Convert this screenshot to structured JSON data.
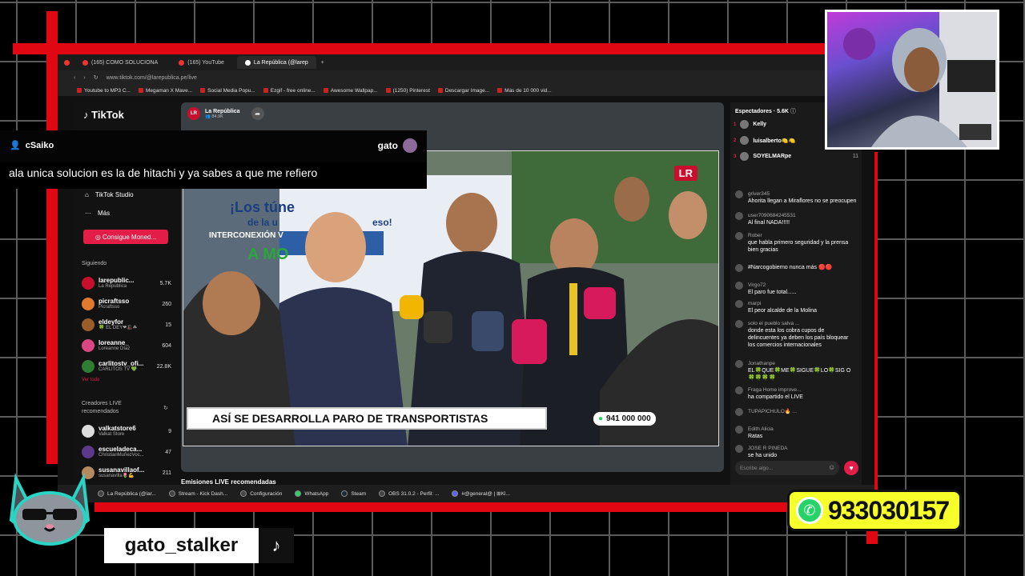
{
  "browser": {
    "tabs": [
      "(165) COMO SOLUCIONA",
      "(165) YouTube",
      "La República (@larep"
    ],
    "address": "www.tiktok.com/@larepublica.pe/live",
    "bookmarks": [
      "Youtube to MP3 C...",
      "Megaman X Mave...",
      "Social Media Popu...",
      "Ezgif - free online...",
      "Awesome Wallpap...",
      "(1250) Pinterest",
      "Descargar Image...",
      "Más de 10 000 vid..."
    ]
  },
  "tiktok": {
    "logo": "TikTok",
    "nav": {
      "studio": "TikTok Studio",
      "more": "Más",
      "coins": "Consigue Moned..."
    },
    "following_header": "Siguiendo",
    "following": [
      {
        "name": "larepublic...",
        "sub": "La República",
        "count": "5.7K",
        "color": "#c8102e"
      },
      {
        "name": "picraftsso",
        "sub": "Picraftsso",
        "count": "260",
        "color": "#e07a2f"
      },
      {
        "name": "eldeyfor",
        "sub": "🍀 EL DEY❤🎩☘",
        "count": "15",
        "color": "#9b5d2a"
      },
      {
        "name": "loreanne_",
        "sub": "Loreanne Díaz",
        "count": "604",
        "color": "#d94680"
      },
      {
        "name": "carlitostv_ofi...",
        "sub": "CARLITOS TV 💚",
        "count": "22.8K",
        "color": "#2e7d32"
      }
    ],
    "see_all": "Ver todo",
    "recommended_header": "Creadores LIVE recomendados",
    "recommended": [
      {
        "name": "valkatstore6",
        "sub": "Valkat Store",
        "count": "9",
        "color": "#ddd"
      },
      {
        "name": "escueladeca...",
        "sub": "ChristianMuñezVoc...",
        "count": "47",
        "color": "#5b3a8a"
      },
      {
        "name": "susanavillaof...",
        "sub": "susanavilla🌷💪",
        "count": "211",
        "color": "#b58a60"
      }
    ],
    "channel_name": "La República",
    "channel_viewers": "84.9K",
    "recommended_live": "Emisiones LIVE recomendadas"
  },
  "video": {
    "banner": "ASÍ SE DESARROLLA PARO DE TRANSPORTISTAS",
    "whatsapp": "941 000 000",
    "logo": "LR",
    "poster_line1": "¡Los túne",
    "poster_line2": "de la u",
    "poster_line3": "eso!",
    "poster_line4": "INTERCONEXIÓN V",
    "poster_line5": "A MO"
  },
  "viewers_panel": {
    "title": "Espectadores · 5.6K",
    "top": [
      {
        "rank": "1",
        "name": "Kelly"
      },
      {
        "rank": "2",
        "name": "luisalberto🍋🍋"
      },
      {
        "rank": "3",
        "name": "SOYELMARpe",
        "count": "11"
      }
    ]
  },
  "chat": [
    {
      "user": "griver345",
      "text": "Ahorita llegan a Miraflores no se preocupen"
    },
    {
      "user": "user7090684245531",
      "text": "Al final NADA!!!!!"
    },
    {
      "user": "Rober",
      "text": "que habla primero seguridad y la prensa bien gracias"
    },
    {
      "user": "",
      "text": "#Narcogobierno nunca más 🔴🔴"
    },
    {
      "user": "Virgo72",
      "text": "El paro fue total......"
    },
    {
      "user": "marpi",
      "text": "El peor alcalde de la Molina"
    },
    {
      "user": "solo el pueblo salva ...",
      "text": "donde esta los cobra cupos de delincuentes ya deben los país bloquear los comercios internacionales"
    },
    {
      "user": "Jonathanpe",
      "text": "EL🍀QUE🍀ME🍀SIGUE🍀LO🍀SIG O🍀🍀🍀🍀"
    },
    {
      "user": "Fraga Home improve...",
      "text": "ha compartido el LIVE"
    },
    {
      "user": "TUPAPICHULO🔥 ...",
      "text": ""
    },
    {
      "user": "Edith Alicia",
      "text": "Ratas"
    },
    {
      "user": "JOSE R PINEDA",
      "text": "se ha unido"
    }
  ],
  "chat_input_placeholder": "Escribe algo...",
  "taskbar": [
    "La República (@lar...",
    "Stream - Kick Dash...",
    "Configuración",
    "WhatsApp",
    "Steam",
    "OBS 31.0.2 - Perfil: ...",
    "#@general@ | ⊞Kl..."
  ],
  "overlay": {
    "user": "cSaiko",
    "streamer": "gato",
    "message": "ala unica solucion es la de hitachi y ya sabes a que me refiero"
  },
  "stream": {
    "handle": "gato_stalker",
    "phone": "933030157"
  }
}
